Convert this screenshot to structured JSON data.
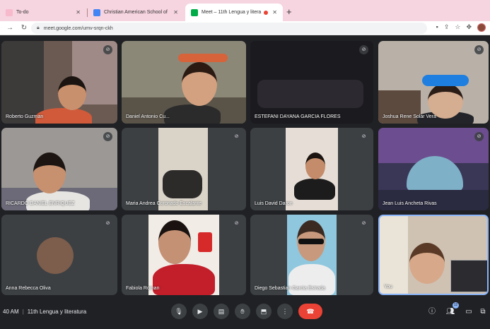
{
  "browser": {
    "tabs": [
      {
        "title": "To-do",
        "favicon_color": "#f7b9cc"
      },
      {
        "title": "Christian American School of",
        "favicon_color": "#4285f4"
      },
      {
        "title": "Meet – 11th Lengua y litera",
        "favicon_color": "#00ac47",
        "recording": true
      }
    ],
    "new_tab": "+",
    "url": "meet.google.com/umv-srqn-ckh"
  },
  "participants": [
    {
      "name": "Roberto Guzman",
      "muted": true
    },
    {
      "name": "Daniel Antonio Cu...",
      "muted": false
    },
    {
      "name": "ESTEFANI DAYANA GARCIA FLORES",
      "muted": true
    },
    {
      "name": "Joshua Rene Solar Vera",
      "muted": true
    },
    {
      "name": "RICARDO DANIEL ENRIQUEZ",
      "muted": true
    },
    {
      "name": "Maria Andrea Coronado Escalante",
      "muted": true
    },
    {
      "name": "Luis David Daron",
      "muted": true
    },
    {
      "name": "Jean Luis Ancheta Rivas",
      "muted": true
    },
    {
      "name": "Anna Rebecca Oliva",
      "muted": true
    },
    {
      "name": "Fabiola Roman",
      "muted": true
    },
    {
      "name": "Diego Sebastian Garcia Estrada",
      "muted": true
    },
    {
      "name": "You",
      "muted": false
    }
  ],
  "meeting": {
    "time": "40 AM",
    "title": "11th Lengua y literatura"
  },
  "controls": {
    "mic_icon": "microphone-icon",
    "camera_icon": "camera-icon",
    "captions_icon": "captions-icon",
    "hand_icon": "raise-hand-icon",
    "present_icon": "present-icon",
    "more_icon": "more-options-icon",
    "end_icon": "end-call-icon",
    "info_icon": "info-icon",
    "people_icon": "people-icon",
    "people_count": "12",
    "chat_icon": "chat-icon",
    "activities_icon": "activities-icon"
  },
  "colors": {
    "stage": "#202124",
    "tile": "#3c4043",
    "end_call": "#ea4335",
    "tab_strip": "#f6d4e0",
    "active_speaker_border": "#8ab4f8"
  }
}
